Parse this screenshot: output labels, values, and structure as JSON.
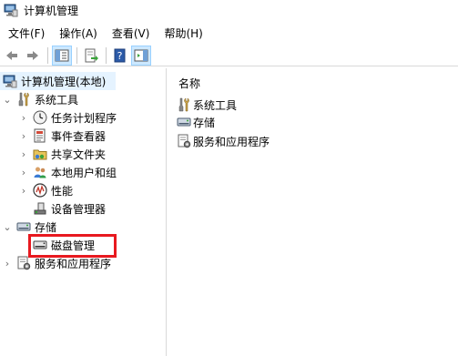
{
  "window": {
    "title": "计算机管理"
  },
  "menu": [
    "文件(F)",
    "操作(A)",
    "查看(V)",
    "帮助(H)"
  ],
  "tree": {
    "root": "计算机管理(本地)",
    "system_tools": "系统工具",
    "task_scheduler": "任务计划程序",
    "event_viewer": "事件查看器",
    "shared_folders": "共享文件夹",
    "local_users": "本地用户和组",
    "performance": "性能",
    "device_manager": "设备管理器",
    "storage": "存储",
    "disk_management": "磁盘管理",
    "services_apps": "服务和应用程序"
  },
  "list": {
    "column_name": "名称",
    "items": [
      "系统工具",
      "存储",
      "服务和应用程序"
    ]
  },
  "colors": {
    "selection": "#e5f3ff",
    "highlight_box": "#e8191f",
    "toolbar_active": "#cce8ff"
  }
}
